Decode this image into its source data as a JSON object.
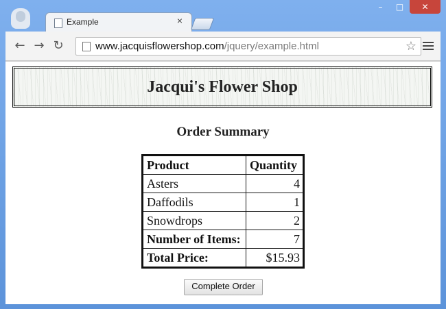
{
  "browser": {
    "tab": {
      "title": "Example",
      "close_glyph": "×"
    },
    "window_controls": {
      "minimize": "–",
      "maximize": "□",
      "close": "✕"
    },
    "toolbar": {
      "back_icon": "←",
      "forward_icon": "→",
      "reload_icon": "↻",
      "url_domain": "www.jacquisflowershop.com",
      "url_path": "/jquery/example.html",
      "star_icon": "☆"
    }
  },
  "page": {
    "shop_title": "Jacqui's Flower Shop",
    "section_title": "Order Summary",
    "table": {
      "headers": [
        "Product",
        "Quantity"
      ],
      "rows": [
        {
          "product": "Asters",
          "quantity": "4"
        },
        {
          "product": "Daffodils",
          "quantity": "1"
        },
        {
          "product": "Snowdrops",
          "quantity": "2"
        }
      ],
      "summary": [
        {
          "label": "Number of Items:",
          "value": "7"
        },
        {
          "label": "Total Price:",
          "value": "$15.93"
        }
      ]
    },
    "button_label": "Complete Order"
  },
  "colors": {
    "window_frame": "#6f9fd8",
    "close_button": "#c7453b",
    "page_background": "#ffffff",
    "table_border": "#111111"
  }
}
